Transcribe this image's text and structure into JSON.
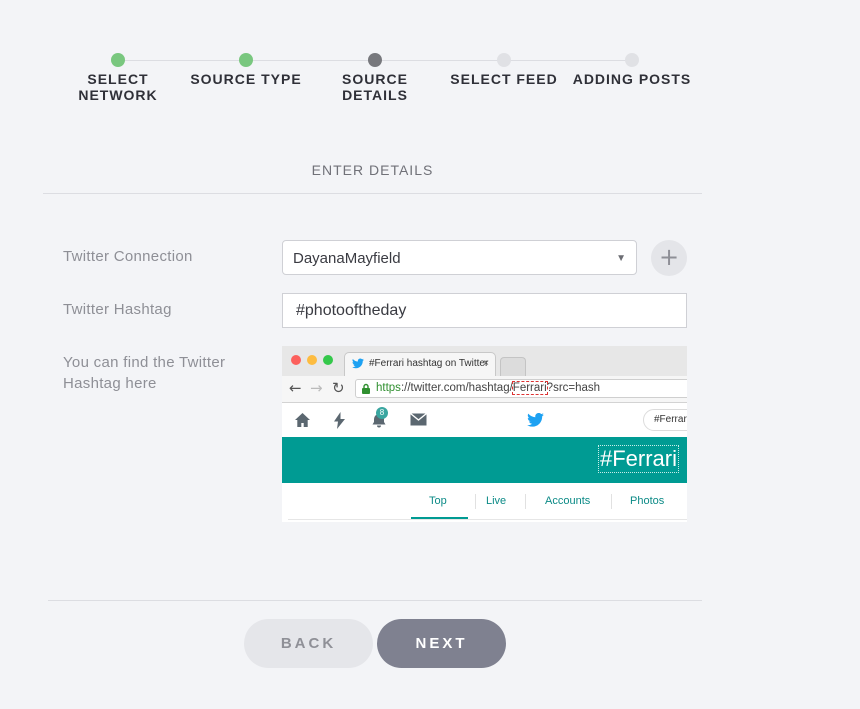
{
  "stepper": {
    "steps": [
      {
        "label": "SELECT\nNETWORK",
        "state": "done"
      },
      {
        "label": "SOURCE TYPE",
        "state": "done"
      },
      {
        "label": "SOURCE DETAILS",
        "state": "current"
      },
      {
        "label": "SELECT FEED",
        "state": "pending"
      },
      {
        "label": "ADDING POSTS",
        "state": "pending"
      }
    ]
  },
  "section": {
    "title": "ENTER DETAILS"
  },
  "form": {
    "connection_label": "Twitter Connection",
    "connection_value": "DayanaMayfield",
    "add_connection_icon": "plus-icon",
    "hashtag_label": "Twitter Hashtag",
    "hashtag_value": "#photooftheday",
    "help_label": "You can find the Twitter Hashtag here"
  },
  "example_screenshot": {
    "tab_title": "#Ferrari hashtag on Twitter",
    "tab_close": "×",
    "url_https": "https",
    "url_middle": "://twitter.com/hashtag/",
    "url_highlight": "Ferrari",
    "url_rest": "?src=hash",
    "notification_count": "8",
    "search_text": "#Ferrari",
    "banner_hashtag": "#Ferrari",
    "tabs": [
      "Top",
      "Live",
      "Accounts",
      "Photos"
    ]
  },
  "footer": {
    "back_label": "BACK",
    "next_label": "NEXT"
  },
  "colors": {
    "done": "#79c77f",
    "current": "#77787d",
    "pending": "#e0e1e5",
    "twitter_teal": "#009b93",
    "next_button": "#7f8190"
  }
}
